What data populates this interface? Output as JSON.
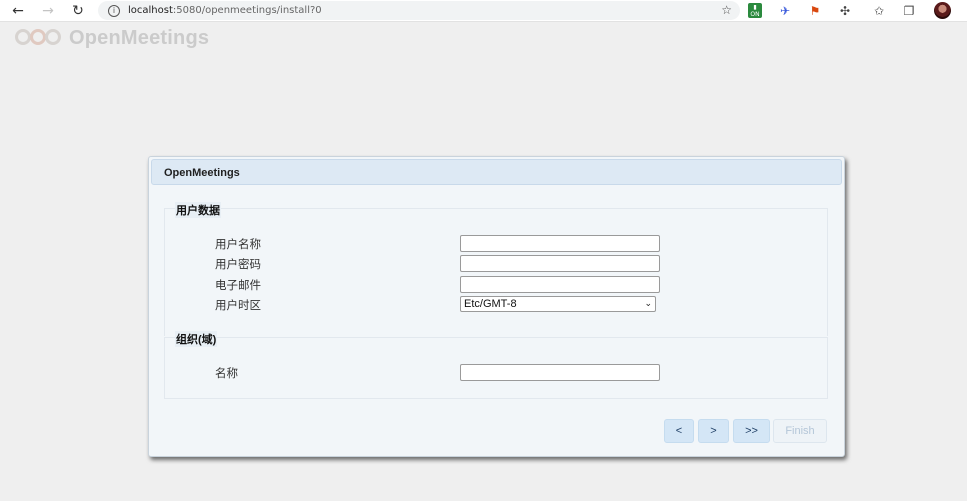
{
  "browser": {
    "url_host": "localhost",
    "url_rest": ":5080/openmeetings/install?0",
    "ext_on_label": "ON"
  },
  "logo": {
    "text": "OpenMeetings"
  },
  "dialog": {
    "title": "OpenMeetings",
    "user_section": {
      "legend": "用户数据",
      "username_label": "用户名称",
      "password_label": "用户密码",
      "email_label": "电子邮件",
      "timezone_label": "用户时区",
      "timezone_value": "Etc/GMT-8"
    },
    "org_section": {
      "legend": "组织(域)",
      "name_label": "名称"
    },
    "buttons": {
      "first": "<",
      "next": ">",
      "last": ">>",
      "finish": "Finish"
    }
  },
  "icons": [
    "back-arrow-icon",
    "forward-arrow-icon",
    "reload-icon",
    "info-icon",
    "star-icon",
    "extensions-puzzle-icon",
    "favorites-icon",
    "collections-icon",
    "chevron-down-icon"
  ]
}
